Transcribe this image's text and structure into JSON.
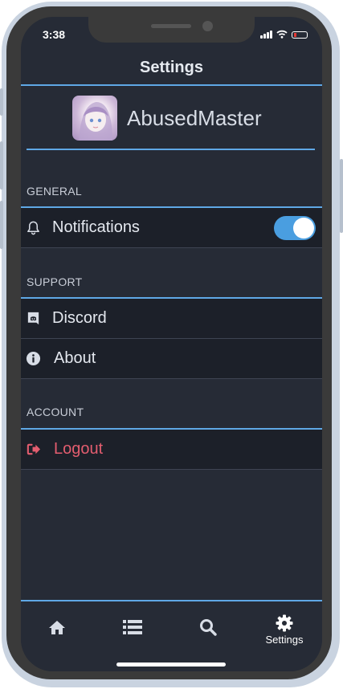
{
  "status_bar": {
    "time": "3:38"
  },
  "header": {
    "title": "Settings"
  },
  "profile": {
    "username": "AbusedMaster"
  },
  "sections": {
    "general": {
      "label": "GENERAL",
      "notifications": {
        "label": "Notifications",
        "enabled": true
      }
    },
    "support": {
      "label": "SUPPORT",
      "discord": {
        "label": "Discord"
      },
      "about": {
        "label": "About"
      }
    },
    "account": {
      "label": "ACCOUNT",
      "logout": {
        "label": "Logout"
      }
    }
  },
  "tabbar": {
    "home_icon": "home-icon",
    "list_icon": "list-icon",
    "search_icon": "search-icon",
    "settings_icon": "gear-icon",
    "settings_label": "Settings"
  },
  "colors": {
    "accent": "#5fa8e6",
    "background": "#262b36",
    "row_background": "#1c2029",
    "logout": "#e35d6f",
    "toggle_on": "#4a9ee0"
  }
}
